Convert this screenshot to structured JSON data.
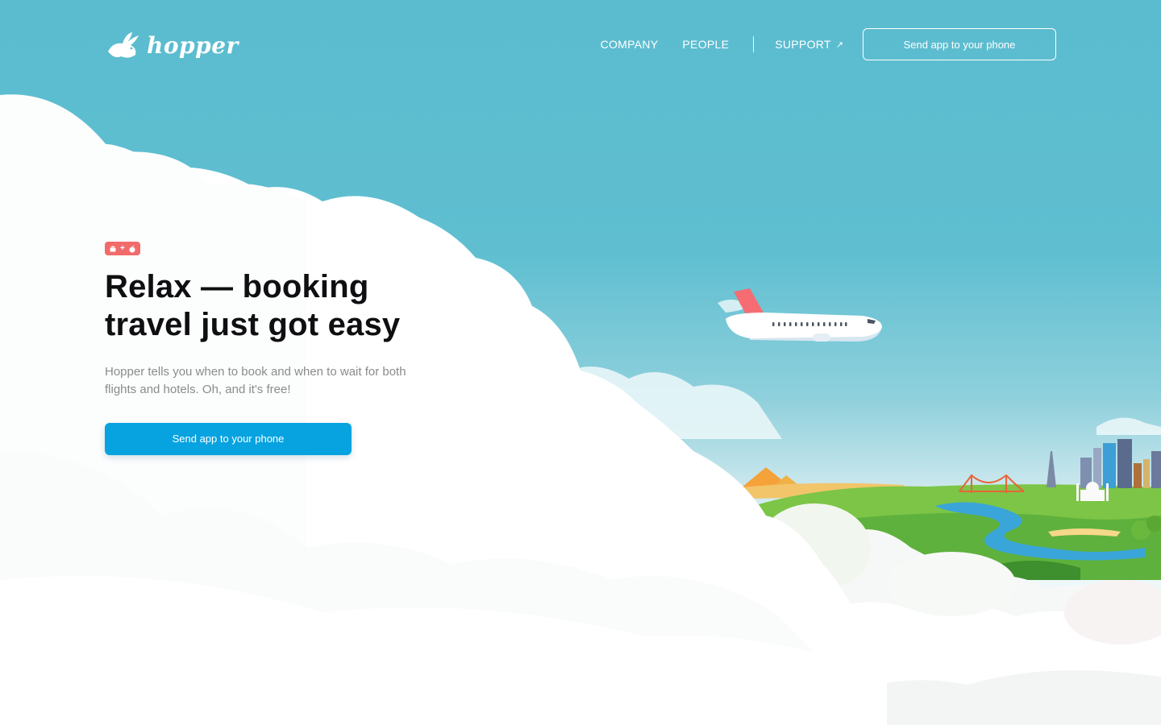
{
  "brand": {
    "name": "hopper"
  },
  "nav": {
    "company": "COMPANY",
    "people": "PEOPLE",
    "support": "SUPPORT",
    "support_icon": "external-arrow-icon",
    "cta": "Send app to your phone"
  },
  "hero": {
    "badge": {
      "android_icon": "android-icon",
      "separator": "+",
      "apple_icon": "apple-icon"
    },
    "headline_line1": "Relax — booking",
    "headline_line2": "travel just got easy",
    "subtext": "Hopper tells you when to book and when to wait for both flights and hotels. Oh, and it's free!",
    "cta": "Send app to your phone"
  },
  "colors": {
    "sky": "#5bbccf",
    "cta_blue": "#06a3e0",
    "badge_red": "#f26b6b",
    "headline": "#0f0f12",
    "subtext": "#8b8b8b"
  }
}
